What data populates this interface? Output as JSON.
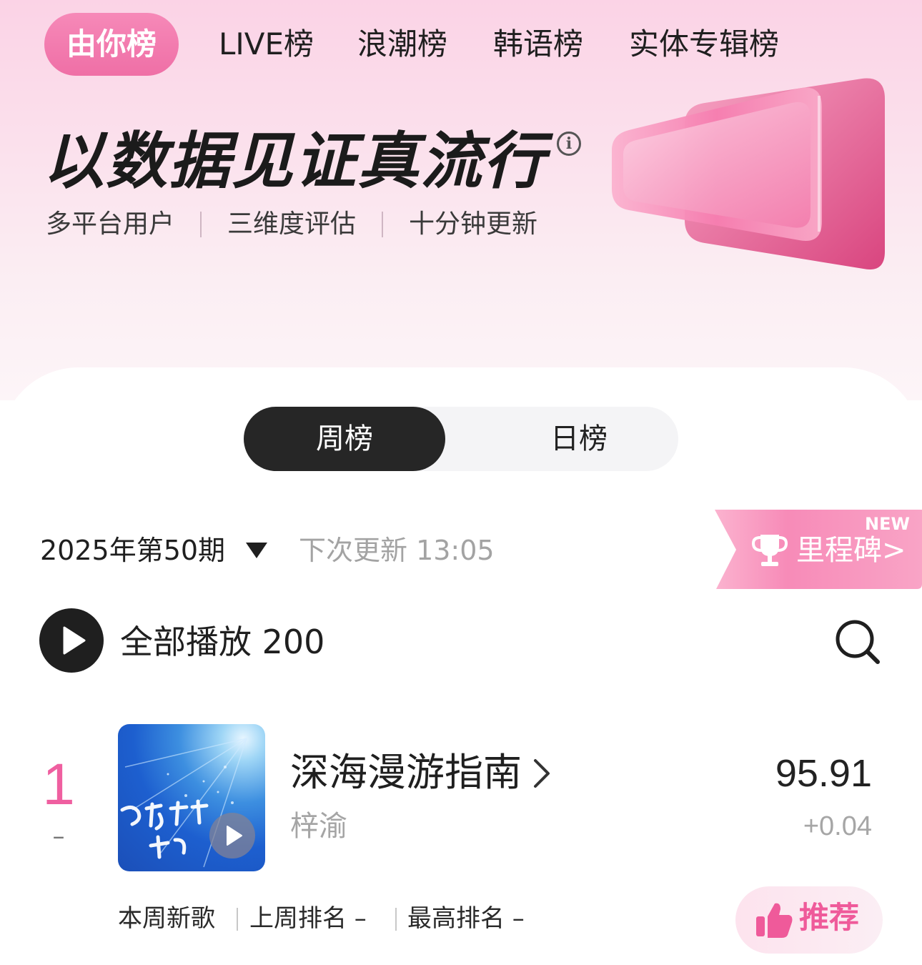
{
  "top_tabs": {
    "active": "由你榜",
    "live": "LIVE榜",
    "wave": "浪潮榜",
    "korean": "韩语榜",
    "album": "实体专辑榜"
  },
  "hero": {
    "slogan": "以数据见证真流行",
    "info_icon": "i",
    "features": [
      "多平台用户",
      "三维度评估",
      "十分钟更新"
    ]
  },
  "segment": {
    "week": "周榜",
    "day": "日榜",
    "selected": "周榜"
  },
  "period": {
    "label": "2025年第50期",
    "next_update": "下次更新 13:05"
  },
  "milestone": {
    "badge": "NEW",
    "label": "里程碑",
    "chevron": ">"
  },
  "play_all": {
    "label": "全部播放 200"
  },
  "icons": {
    "play": "play-icon",
    "search": "search-icon",
    "trophy": "trophy-icon",
    "thumbs_up": "thumbs-up-icon",
    "caret": "caret-down-icon",
    "chevron": "chevron-right-icon"
  },
  "song": {
    "rank": "1",
    "rank_change": "–",
    "title": "深海漫游指南",
    "artist": "梓渝",
    "score": "95.91",
    "score_delta": "+0.04",
    "meta": [
      "本周新歌",
      "上周排名 –",
      "最高排名 –"
    ],
    "recommend": "推荐"
  },
  "colors": {
    "accent_pink": "#ef5fa0",
    "dark": "#262626"
  }
}
